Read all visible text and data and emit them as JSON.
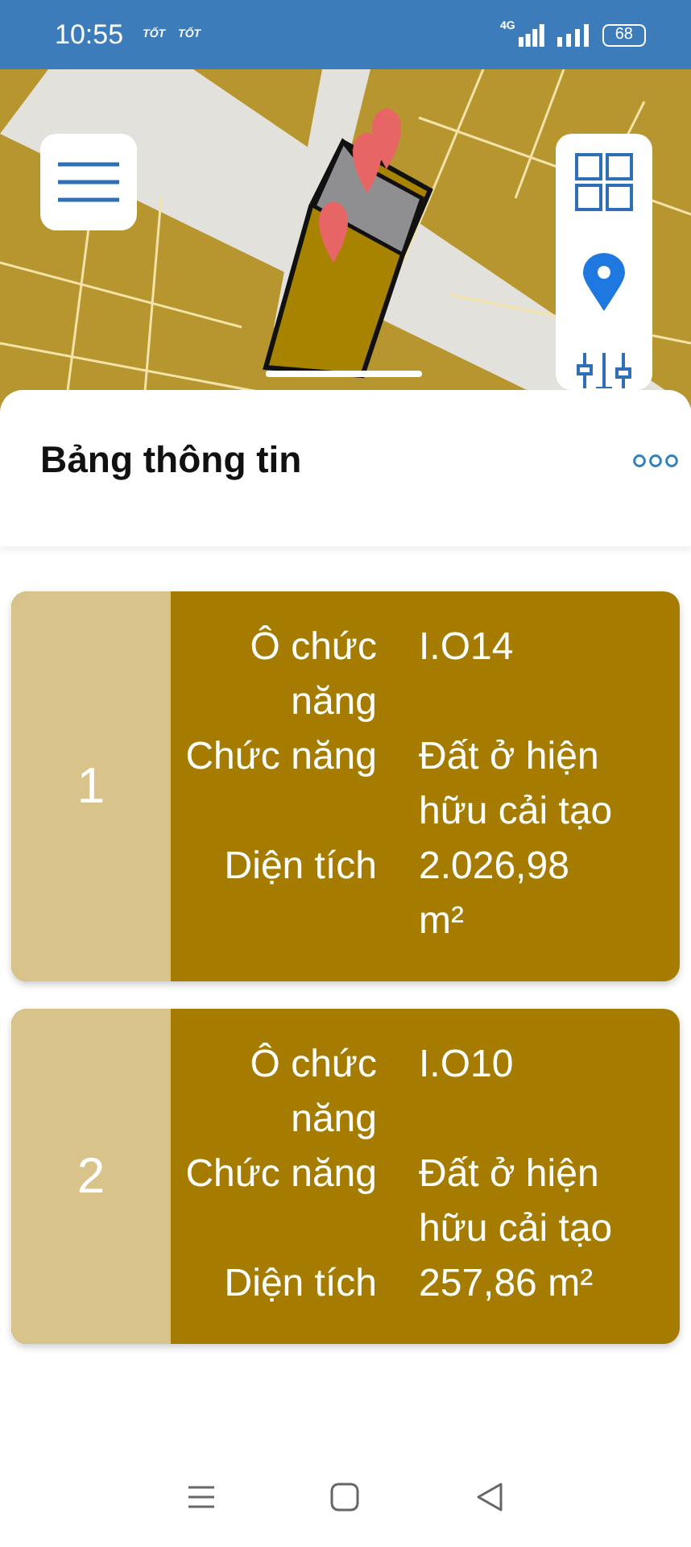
{
  "status_bar": {
    "time": "10:55",
    "carrier_labels": [
      "TỐT",
      "TỐT"
    ],
    "network": "4G",
    "battery": "68"
  },
  "panel": {
    "title": "Bảng thông tin"
  },
  "parcels": [
    {
      "number": "1",
      "rows": [
        {
          "label": "Ô chức năng",
          "value": "I.O14"
        },
        {
          "label": "Chức năng",
          "value": "Đất ở hiện hữu cải tạo"
        },
        {
          "label": "Diện tích",
          "value": "2.026,98 m²"
        }
      ]
    },
    {
      "number": "2",
      "rows": [
        {
          "label": "Ô chức năng",
          "value": "I.O10"
        },
        {
          "label": "Chức năng",
          "value": "Đất ở hiện hữu cải tạo"
        },
        {
          "label": "Diện tích",
          "value": "257,86 m²"
        }
      ]
    }
  ]
}
